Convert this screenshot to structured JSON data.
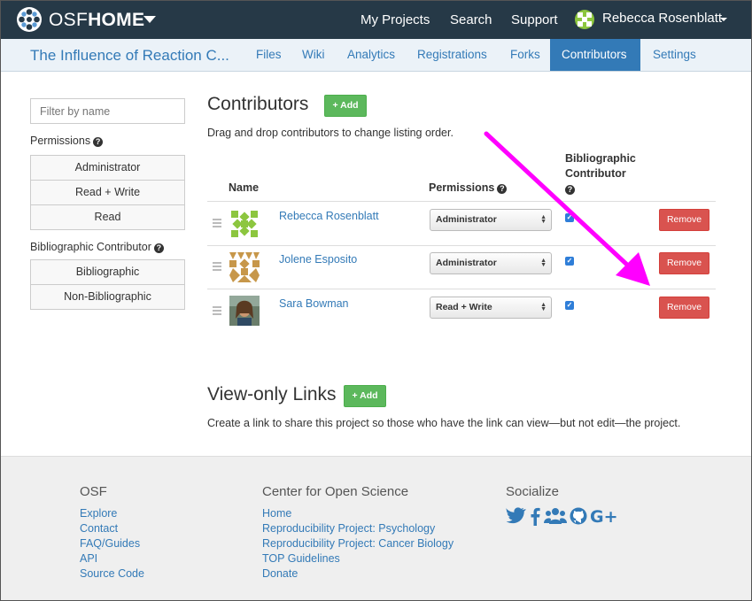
{
  "colors": {
    "nav_bg": "#263947",
    "project_nav_bg": "#ebf2f8",
    "link_blue": "#337ab7",
    "add_green": "#5cb85c",
    "remove_red": "#d9534f",
    "annotation_arrow": "#ff00ff"
  },
  "topnav": {
    "brand_osf": "OSF",
    "brand_home": "HOME",
    "logo_icon": "osf-flower-logo",
    "links": [
      "My Projects",
      "Search",
      "Support"
    ],
    "user_name": "Rebecca Rosenblatt"
  },
  "project_nav": {
    "title": "The Influence of Reaction C...",
    "tabs": [
      {
        "label": "Files",
        "active": false
      },
      {
        "label": "Wiki",
        "active": false
      },
      {
        "label": "Analytics",
        "active": false
      },
      {
        "label": "Registrations",
        "active": false
      },
      {
        "label": "Forks",
        "active": false
      },
      {
        "label": "Contributors",
        "active": true
      },
      {
        "label": "Settings",
        "active": false
      }
    ]
  },
  "sidebar": {
    "filter_placeholder": "Filter by name",
    "permissions_heading": "Permissions",
    "permission_filters": [
      "Administrator",
      "Read + Write",
      "Read"
    ],
    "bibliographic_heading": "Bibliographic Contributor",
    "bibliographic_filters": [
      "Bibliographic",
      "Non-Bibliographic"
    ]
  },
  "contributors": {
    "heading": "Contributors",
    "add_label": "+ Add",
    "hint": "Drag and drop contributors to change listing order.",
    "columns": {
      "name": "Name",
      "permissions": "Permissions",
      "bibliographic_line1": "Bibliographic",
      "bibliographic_line2": "Contributor"
    },
    "rows": [
      {
        "name": "Rebecca Rosenblatt",
        "permission": "Administrator",
        "bibliographic": true,
        "remove_label": "Remove"
      },
      {
        "name": "Jolene Esposito",
        "permission": "Administrator",
        "bibliographic": true,
        "remove_label": "Remove"
      },
      {
        "name": "Sara Bowman",
        "permission": "Read + Write",
        "bibliographic": true,
        "remove_label": "Remove"
      }
    ]
  },
  "view_only_links": {
    "heading": "View-only Links",
    "add_label": "+ Add",
    "description": "Create a link to share this project so those who have the link can view—but not edit—the project."
  },
  "footer": {
    "osf_heading": "OSF",
    "osf_links": [
      "Explore",
      "Contact",
      "FAQ/Guides",
      "API",
      "Source Code"
    ],
    "cos_heading": "Center for Open Science",
    "cos_links": [
      "Home",
      "Reproducibility Project: Psychology",
      "Reproducibility Project: Cancer Biology",
      "TOP Guidelines",
      "Donate"
    ],
    "social_heading": "Socialize",
    "social_icons": [
      "twitter-icon",
      "facebook-icon",
      "group-icon",
      "github-icon",
      "google-plus-icon"
    ]
  }
}
